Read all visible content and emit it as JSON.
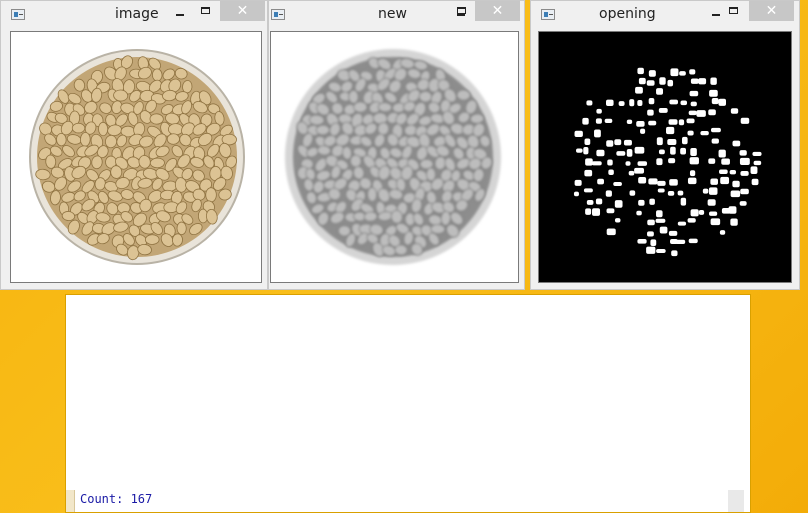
{
  "windows": [
    {
      "id": "image",
      "title": "image",
      "close_glyph": "✕"
    },
    {
      "id": "new",
      "title": "new",
      "close_glyph": "✕"
    },
    {
      "id": "opening",
      "title": "opening",
      "close_glyph": "✕"
    }
  ],
  "console": {
    "output_text": "Count: 167"
  },
  "colors": {
    "desktop": "#f6b20c",
    "window_frame": "#f0f0f0",
    "close_button": "#c7c7c7",
    "console_text": "#1a1aa6",
    "bean_tan": "#d6bb8a",
    "bean_gray": "#b9b9b9"
  },
  "icons": [
    "app-icon",
    "minimize-icon",
    "maximize-icon",
    "close-icon"
  ]
}
